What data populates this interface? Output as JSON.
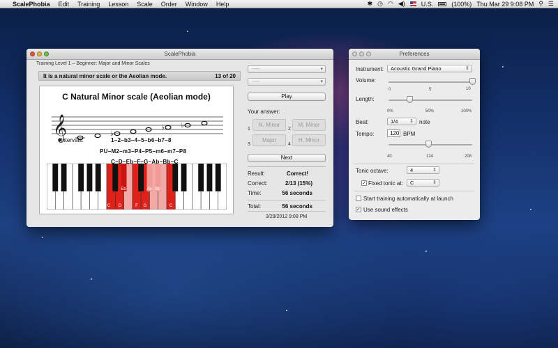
{
  "menubar": {
    "apple": "",
    "app_name": "ScalePhobia",
    "items": [
      "Edit",
      "Training",
      "Lesson",
      "Scale",
      "Order",
      "Window",
      "Help"
    ],
    "battery": "(100%)",
    "input_source": "U.S.",
    "clock": "Thu Mar 29  9:08 PM"
  },
  "main": {
    "title": "ScalePhobia",
    "subtitle": "Training Level 1 – Beginner: Major and Minor Scales",
    "question": "It is a natural minor scale or the Aeolian mode.",
    "progress": "13 of 20",
    "scale_title": "C Natural Minor scale (Aeolian mode)",
    "intervals_label": "Intervals:",
    "intervals_line": "1–2–b3–4–5–b6–b7–8",
    "steps_line": "PU–M2–m3–P4–P5–m6–m7–P8",
    "notes_line": "C–D–Eb–F–G–Ab–Bb–C",
    "key_labels": {
      "c1": "C",
      "d": "D",
      "f": "F",
      "g": "G",
      "c2": "C",
      "eb": "Eb",
      "ab": "Ab",
      "bb": "Bb"
    },
    "dropdown1": "-----",
    "dropdown2": "-----",
    "play_label": "Play",
    "your_answer_label": "Your answer:",
    "answers": [
      {
        "num": "1",
        "label": "N. Minor"
      },
      {
        "num": "2",
        "label": "M. Minor"
      },
      {
        "num": "3",
        "label": "Major"
      },
      {
        "num": "4",
        "label": "H. Minor"
      }
    ],
    "next_label": "Next",
    "result_label": "Result:",
    "result_value": "Correct!",
    "correct_label": "Correct:",
    "correct_value": "2/13 (15%)",
    "time_label": "Time:",
    "time_value": "56 seconds",
    "total_label": "Total:",
    "total_value": "56 seconds",
    "timestamp": "3/29/2012 9:08 PM"
  },
  "prefs": {
    "title": "Preferences",
    "instrument_label": "Instrument:",
    "instrument_value": "Acoustic Grand Piano",
    "volume_label": "Volume:",
    "volume_min": "0",
    "volume_mid": "5",
    "volume_max": "10",
    "volume_value": 1.0,
    "length_label": "Length:",
    "length_min": "0%",
    "length_mid": "50%",
    "length_max": "100%",
    "length_value": 0.25,
    "beat_label": "Beat:",
    "beat_value": "1/4",
    "beat_unit": "note",
    "tempo_label": "Tempo:",
    "tempo_value": "120",
    "tempo_unit": "BPM",
    "tempo_min": "40",
    "tempo_mid": "124",
    "tempo_max": "208",
    "tonic_octave_label": "Tonic octave:",
    "tonic_octave_value": "4",
    "fixed_tonic_label": "Fixed tonic at:",
    "fixed_tonic_value": "C",
    "fixed_tonic_checked": true,
    "auto_start_label": "Start training automatically at launch",
    "auto_start_checked": false,
    "sound_effects_label": "Use sound effects",
    "sound_effects_checked": true
  },
  "colors": {
    "highlight_white_key": "#e0211b",
    "highlight_black_key": "#c91612",
    "light_black_key": "#f29a96",
    "light_white_key": "#f3a9a5"
  }
}
